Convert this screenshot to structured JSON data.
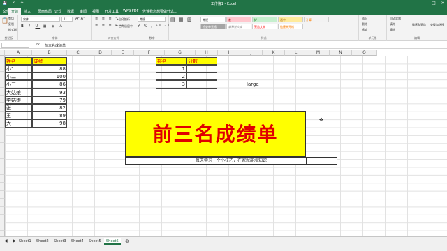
{
  "window": {
    "title": "工作簿1 - Excel"
  },
  "ribbon_tabs": [
    "文件",
    "开始",
    "插入",
    "页面布局",
    "公式",
    "数据",
    "审阅",
    "视图",
    "开发工具",
    "WPS PDF",
    "告诉我您想要做什么..."
  ],
  "ribbon": {
    "clipboard": {
      "cut": "剪切",
      "copy": "复制",
      "format_painter": "格式刷",
      "label": "剪贴板"
    },
    "font": {
      "name": "宋体",
      "size": "11",
      "label": "字体"
    },
    "alignment": {
      "wrap": "自动换行",
      "merge": "合并后居中",
      "label": "对齐方式"
    },
    "number": {
      "format": "常规",
      "label": "数字"
    },
    "styles": {
      "cells": [
        "常规",
        "差",
        "好",
        "适中",
        "计算",
        "检查单元格",
        "解释性文本",
        "警告文本",
        "链接单元格"
      ],
      "label": "样式"
    },
    "cells_group": {
      "insert": "插入",
      "delete": "删除",
      "format": "格式",
      "label": "单元格"
    },
    "editing": {
      "autosum": "自动求和",
      "fill": "填充",
      "clear": "清除",
      "sort": "排序和筛选",
      "find": "查找和选择",
      "label": "编辑"
    }
  },
  "formula_bar": {
    "name_box": "",
    "content": "前三名成绩单"
  },
  "columns": [
    "A",
    "B",
    "C",
    "D",
    "E",
    "F",
    "G",
    "H",
    "I",
    "J",
    "K",
    "L",
    "M",
    "N",
    "O"
  ],
  "table_scores": {
    "headers": [
      "姓名",
      "成绩"
    ],
    "rows": [
      {
        "name": "小1",
        "score": "88"
      },
      {
        "name": "小二",
        "score": "100"
      },
      {
        "name": "小三",
        "score": "86"
      },
      {
        "name": "大姑娘",
        "score": "93"
      },
      {
        "name": "李姑娘",
        "score": "79"
      },
      {
        "name": "张",
        "score": "82"
      },
      {
        "name": "王",
        "score": "89"
      },
      {
        "name": "大",
        "score": "98"
      }
    ]
  },
  "table_rank": {
    "headers": [
      "排名",
      "分数"
    ],
    "ranks": [
      "1",
      "2",
      "3"
    ]
  },
  "large_label": "large",
  "banner": {
    "title": "前三名成绩单",
    "subtitle": "每天学习一个小技巧，在家就能涨知识"
  },
  "sheets": [
    "Sheet1",
    "Sheet2",
    "Sheet3",
    "Sheet4",
    "Sheet5",
    "Sheet6"
  ],
  "active_sheet": "Sheet6",
  "colors": {
    "excel_green": "#217346",
    "highlight_yellow": "#ffff00",
    "header_red": "#e00000"
  }
}
